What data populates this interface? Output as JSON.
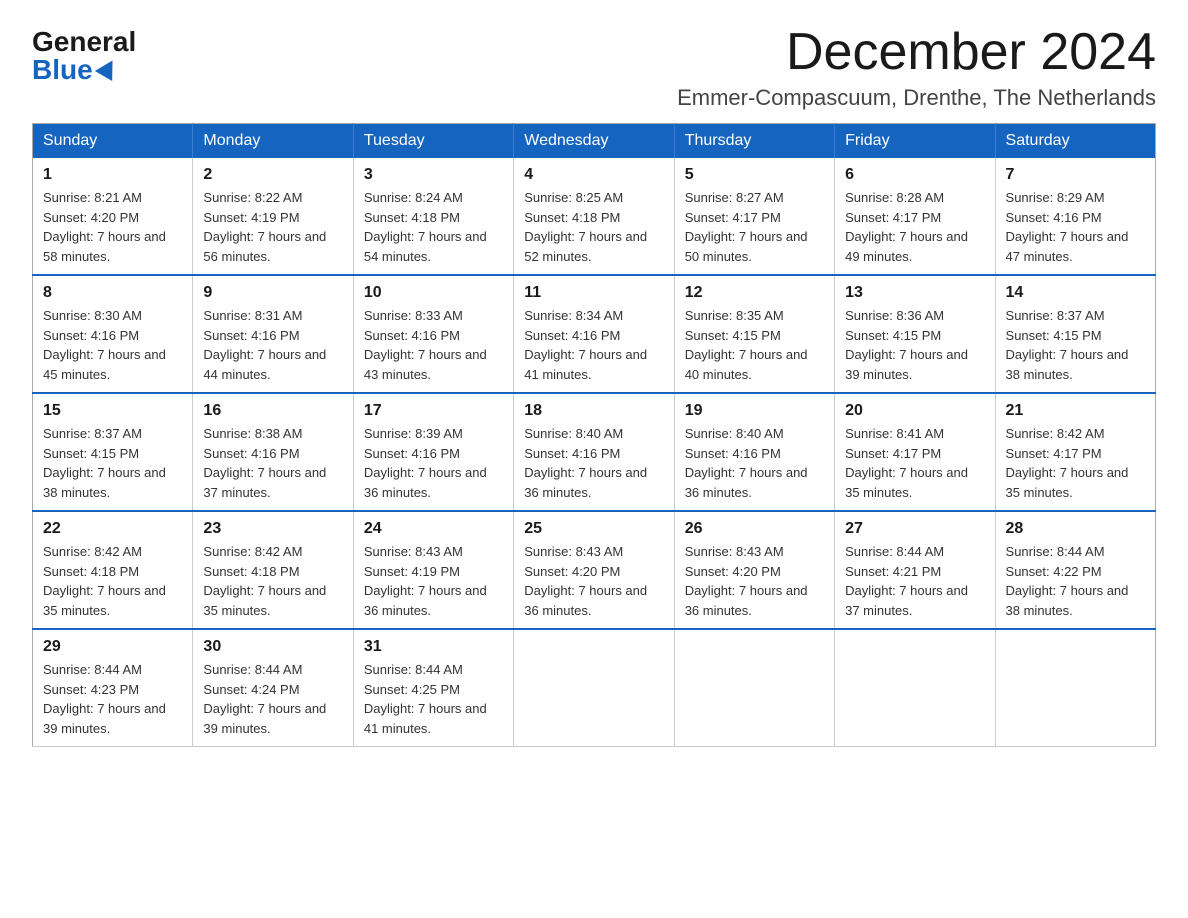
{
  "logo": {
    "general": "General",
    "blue": "Blue"
  },
  "title": "December 2024",
  "subtitle": "Emmer-Compascuum, Drenthe, The Netherlands",
  "weekdays": [
    "Sunday",
    "Monday",
    "Tuesday",
    "Wednesday",
    "Thursday",
    "Friday",
    "Saturday"
  ],
  "weeks": [
    [
      {
        "day": "1",
        "sunrise": "8:21 AM",
        "sunset": "4:20 PM",
        "daylight": "7 hours and 58 minutes."
      },
      {
        "day": "2",
        "sunrise": "8:22 AM",
        "sunset": "4:19 PM",
        "daylight": "7 hours and 56 minutes."
      },
      {
        "day": "3",
        "sunrise": "8:24 AM",
        "sunset": "4:18 PM",
        "daylight": "7 hours and 54 minutes."
      },
      {
        "day": "4",
        "sunrise": "8:25 AM",
        "sunset": "4:18 PM",
        "daylight": "7 hours and 52 minutes."
      },
      {
        "day": "5",
        "sunrise": "8:27 AM",
        "sunset": "4:17 PM",
        "daylight": "7 hours and 50 minutes."
      },
      {
        "day": "6",
        "sunrise": "8:28 AM",
        "sunset": "4:17 PM",
        "daylight": "7 hours and 49 minutes."
      },
      {
        "day": "7",
        "sunrise": "8:29 AM",
        "sunset": "4:16 PM",
        "daylight": "7 hours and 47 minutes."
      }
    ],
    [
      {
        "day": "8",
        "sunrise": "8:30 AM",
        "sunset": "4:16 PM",
        "daylight": "7 hours and 45 minutes."
      },
      {
        "day": "9",
        "sunrise": "8:31 AM",
        "sunset": "4:16 PM",
        "daylight": "7 hours and 44 minutes."
      },
      {
        "day": "10",
        "sunrise": "8:33 AM",
        "sunset": "4:16 PM",
        "daylight": "7 hours and 43 minutes."
      },
      {
        "day": "11",
        "sunrise": "8:34 AM",
        "sunset": "4:16 PM",
        "daylight": "7 hours and 41 minutes."
      },
      {
        "day": "12",
        "sunrise": "8:35 AM",
        "sunset": "4:15 PM",
        "daylight": "7 hours and 40 minutes."
      },
      {
        "day": "13",
        "sunrise": "8:36 AM",
        "sunset": "4:15 PM",
        "daylight": "7 hours and 39 minutes."
      },
      {
        "day": "14",
        "sunrise": "8:37 AM",
        "sunset": "4:15 PM",
        "daylight": "7 hours and 38 minutes."
      }
    ],
    [
      {
        "day": "15",
        "sunrise": "8:37 AM",
        "sunset": "4:15 PM",
        "daylight": "7 hours and 38 minutes."
      },
      {
        "day": "16",
        "sunrise": "8:38 AM",
        "sunset": "4:16 PM",
        "daylight": "7 hours and 37 minutes."
      },
      {
        "day": "17",
        "sunrise": "8:39 AM",
        "sunset": "4:16 PM",
        "daylight": "7 hours and 36 minutes."
      },
      {
        "day": "18",
        "sunrise": "8:40 AM",
        "sunset": "4:16 PM",
        "daylight": "7 hours and 36 minutes."
      },
      {
        "day": "19",
        "sunrise": "8:40 AM",
        "sunset": "4:16 PM",
        "daylight": "7 hours and 36 minutes."
      },
      {
        "day": "20",
        "sunrise": "8:41 AM",
        "sunset": "4:17 PM",
        "daylight": "7 hours and 35 minutes."
      },
      {
        "day": "21",
        "sunrise": "8:42 AM",
        "sunset": "4:17 PM",
        "daylight": "7 hours and 35 minutes."
      }
    ],
    [
      {
        "day": "22",
        "sunrise": "8:42 AM",
        "sunset": "4:18 PM",
        "daylight": "7 hours and 35 minutes."
      },
      {
        "day": "23",
        "sunrise": "8:42 AM",
        "sunset": "4:18 PM",
        "daylight": "7 hours and 35 minutes."
      },
      {
        "day": "24",
        "sunrise": "8:43 AM",
        "sunset": "4:19 PM",
        "daylight": "7 hours and 36 minutes."
      },
      {
        "day": "25",
        "sunrise": "8:43 AM",
        "sunset": "4:20 PM",
        "daylight": "7 hours and 36 minutes."
      },
      {
        "day": "26",
        "sunrise": "8:43 AM",
        "sunset": "4:20 PM",
        "daylight": "7 hours and 36 minutes."
      },
      {
        "day": "27",
        "sunrise": "8:44 AM",
        "sunset": "4:21 PM",
        "daylight": "7 hours and 37 minutes."
      },
      {
        "day": "28",
        "sunrise": "8:44 AM",
        "sunset": "4:22 PM",
        "daylight": "7 hours and 38 minutes."
      }
    ],
    [
      {
        "day": "29",
        "sunrise": "8:44 AM",
        "sunset": "4:23 PM",
        "daylight": "7 hours and 39 minutes."
      },
      {
        "day": "30",
        "sunrise": "8:44 AM",
        "sunset": "4:24 PM",
        "daylight": "7 hours and 39 minutes."
      },
      {
        "day": "31",
        "sunrise": "8:44 AM",
        "sunset": "4:25 PM",
        "daylight": "7 hours and 41 minutes."
      },
      null,
      null,
      null,
      null
    ]
  ]
}
